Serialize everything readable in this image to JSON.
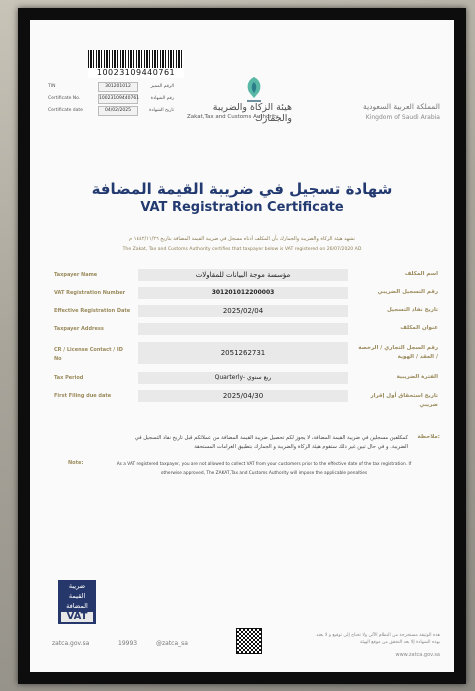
{
  "header": {
    "barcode_number": "10023109440761",
    "meta": {
      "tin_label": "TIN",
      "tin_value": "301201012",
      "tin_label_ar": "الرقم المميز",
      "cert_label": "Certificate No.",
      "cert_value": "10023109440761",
      "cert_label_ar": "رقم الشهادة",
      "date_label": "Certificate date",
      "date_value": "04/02/2025",
      "date_label_ar": "تاريخ الشهادة"
    },
    "authority_ar": "هيئة الزكاة والضريبة والجمارك",
    "authority_en": "Zakat,Tax and Customs Authority",
    "kingdom_ar": "المملكة العربية السعودية",
    "kingdom_en": "Kingdom of Saudi Arabia"
  },
  "title": {
    "ar": "شهادة تسجيل في ضريبة القيمة المضافة",
    "en": "VAT Registration Certificate"
  },
  "statement": {
    "ar": "تشهد هيئة الزكاة والضريبة والجمارك بأن المكلف أدناه مسجل في ضريبة القيمة المضافة بتاريخ ١٤٤٢/١١/٢٦ م",
    "en": "The Zakat, Tax and Customs Authority certifies that taxpayer below is VAT registered on 26/07/2020 AD"
  },
  "fields": [
    {
      "label_en": "Taxpayer Name",
      "value": "مؤسسة موجة البيانات للمقاولات",
      "label_ar": "اسم المكلف"
    },
    {
      "label_en": "VAT Registration Number",
      "value": "301201012200003",
      "label_ar": "رقم التسجيل الضريبي"
    },
    {
      "label_en": "Effective Registration Date",
      "value": "2025/02/04",
      "label_ar": "تاريخ نفاذ التسجيل"
    },
    {
      "label_en": "Taxpayer Address",
      "value": "",
      "label_ar": "عنوان المكلف"
    },
    {
      "label_en": "CR / License Contact / ID No",
      "value": "2051262731",
      "label_ar": "رقم السجل التجاري / الرخصة / العقد / الهوية"
    },
    {
      "label_en": "Tax Period",
      "value": "Quarterly- ربع سنوي",
      "label_ar": "الفترة الضريبية"
    },
    {
      "label_en": "First Filing due date",
      "value": "2025/04/30",
      "label_ar": "تاريخ استحقاق أول إقرار ضريبي"
    }
  ],
  "notes": {
    "ar_label": "ملاحظة:",
    "ar_text": "كمكلفين مسجلين في ضريبة القيمة المضافة، لا يجوز لكم تحصيل ضريبة القيمة المضافة من عملائكم قبل تاريخ نفاذ التسجيل في الضريبة. و في حال تبين غير ذلك ستقوم هيئة الزكاة والضريبة و الجمارك بتطبيق الغرامات المستحقة",
    "en_label": "Note:",
    "en_text": "As a VAT registered taxpayer, you are not allowed to collect VAT from your customers prior to the effective date of the tax registration. If otherwise approved, The ZAKAT,Tax and Customs Authority will impose the applicable penalties"
  },
  "vat_logo": {
    "line1": "ضريبة",
    "line2": "القيمة",
    "line3": "المضافة",
    "mark": "VAT"
  },
  "footer": {
    "website": "zatca.gov.sa",
    "phone": "19993",
    "handle": "@zatca_sa",
    "disclaimer_ar": "هذه الوثيقة مستخرجة من النظام الآلي ولا تحتاج إلى توقيع و لا يعتد بهذه الشهادة إلا بعد التحقق من موقع الهيئة",
    "url": "www.zatca.gov.sa"
  }
}
